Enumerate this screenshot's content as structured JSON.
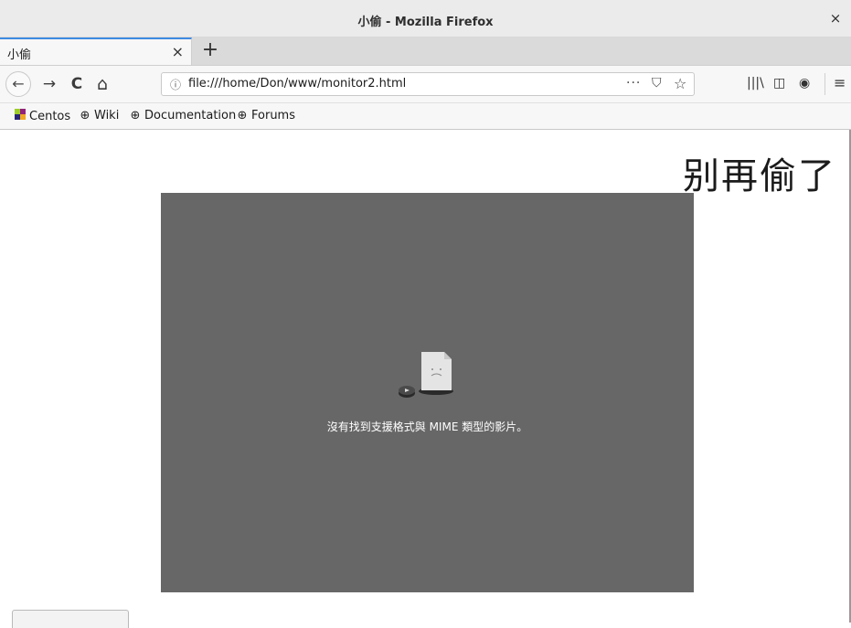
{
  "window": {
    "title": "小偷 - Mozilla Firefox",
    "close_glyph": "×"
  },
  "tabs": [
    {
      "label": "小偷",
      "close_glyph": "×"
    }
  ],
  "newtab_glyph": "+",
  "nav": {
    "back_glyph": "←",
    "forward_glyph": "→",
    "reload_glyph": "C",
    "home_glyph": "⌂",
    "url": "file:///home/Don/www/monitor2.html",
    "info_glyph": "ⓘ",
    "more_glyph": "···",
    "pocket_glyph": "⛉",
    "star_glyph": "☆",
    "library_glyph": "|||\\",
    "sidebar_glyph": "◫",
    "account_glyph": "◉",
    "menu_glyph": "≡"
  },
  "bookmarks": [
    {
      "label": "Centos",
      "icon": "centos-icon"
    },
    {
      "label": "Wiki",
      "icon": "globe-icon"
    },
    {
      "label": "Documentation",
      "icon": "globe-icon"
    },
    {
      "label": "Forums",
      "icon": "globe-icon"
    }
  ],
  "page": {
    "heading": "别再偷了",
    "video_error": "沒有找到支援格式與 MIME 類型的影片。"
  }
}
